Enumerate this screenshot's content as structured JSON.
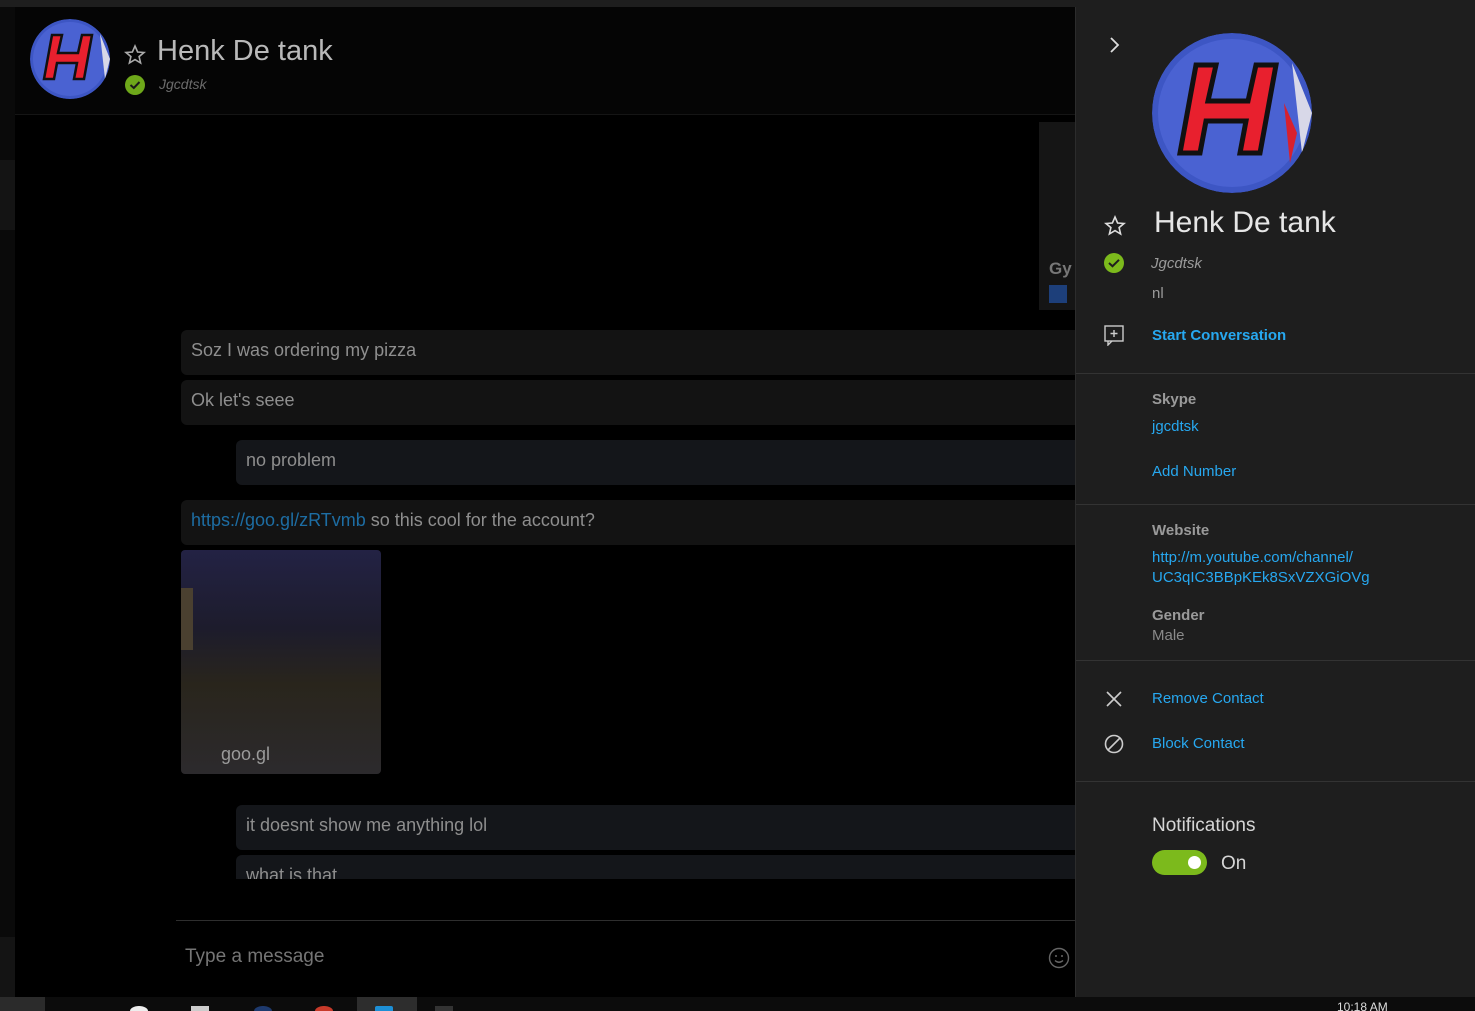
{
  "contact": {
    "name": "Henk De tank",
    "mood": "Jgcdtsk",
    "location": "nl"
  },
  "chat": {
    "partial_card_text": "Gy",
    "messages": [
      {
        "text": "Soz I was ordering my pizza"
      },
      {
        "text": "Ok let's seee"
      },
      {
        "text": "no problem"
      },
      {
        "link": "https://goo.gl/zRTvmb",
        "text": " so this cool for the account?"
      },
      {
        "text": "it doesnt show me anything lol"
      },
      {
        "text": "what is that"
      }
    ],
    "link_preview_domain": "goo.gl",
    "compose_placeholder": "Type a message"
  },
  "panel": {
    "start_conversation": "Start Conversation",
    "skype_label": "Skype",
    "skype_id": "jgcdtsk",
    "add_number": "Add Number",
    "website_label": "Website",
    "website_line1": "http://m.youtube.com/channel/",
    "website_line2": "UC3qIC3BBpKEk8SxVZXGiOVg",
    "gender_label": "Gender",
    "gender_value": "Male",
    "remove_contact": "Remove Contact",
    "block_contact": "Block Contact",
    "notifications_label": "Notifications",
    "notifications_state": "On"
  },
  "taskbar": {
    "clock": "10:18 AM"
  },
  "colors": {
    "accent_link": "#27a8f0",
    "status_green": "#7cba1c",
    "panel_bg": "#1e1e1e"
  },
  "icons": [
    "star-icon",
    "status-check-icon",
    "chevron-right-icon",
    "add-conversation-icon",
    "close-icon",
    "block-icon",
    "emoji-icon"
  ]
}
